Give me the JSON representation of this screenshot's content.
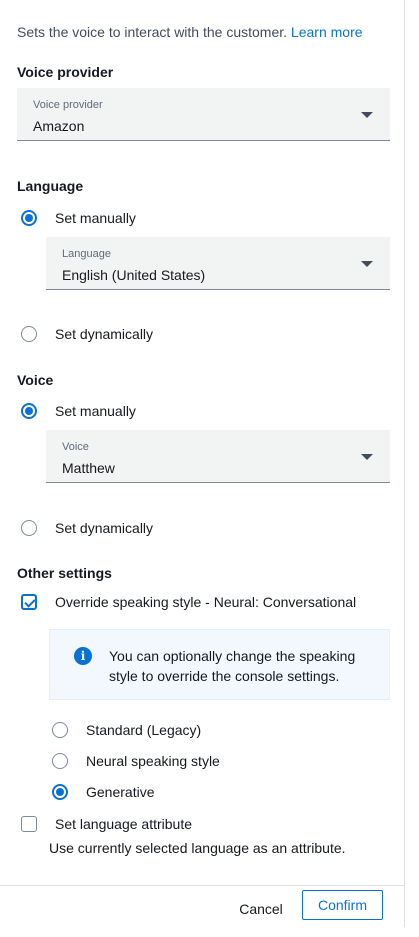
{
  "intro": {
    "text": "Sets the voice to interact with the customer.",
    "link": "Learn more"
  },
  "voice_provider": {
    "section_title": "Voice provider",
    "select_label": "Voice provider",
    "select_value": "Amazon"
  },
  "language": {
    "section_title": "Language",
    "manual_label": "Set manually",
    "select_label": "Language",
    "select_value": "English (United States)",
    "dynamic_label": "Set dynamically",
    "selected": "manual"
  },
  "voice": {
    "section_title": "Voice",
    "manual_label": "Set manually",
    "select_label": "Voice",
    "select_value": "Matthew",
    "dynamic_label": "Set dynamically",
    "selected": "manual"
  },
  "other_settings": {
    "section_title": "Other settings",
    "override_label": "Override speaking style - Neural: Conversational",
    "override_checked": true,
    "info_text": "You can optionally change the speaking style to override the console settings.",
    "styles": [
      {
        "label": "Standard (Legacy)",
        "selected": false
      },
      {
        "label": "Neural speaking style",
        "selected": false
      },
      {
        "label": "Generative",
        "selected": true
      }
    ],
    "language_attr_label": "Set language attribute",
    "language_attr_checked": false,
    "language_attr_desc": "Use currently selected language as an attribute."
  },
  "footer": {
    "cancel": "Cancel",
    "confirm": "Confirm"
  },
  "colors": {
    "accent": "#0972d3",
    "info_bg": "#f2f8fd",
    "select_bg": "#f2f3f3"
  }
}
